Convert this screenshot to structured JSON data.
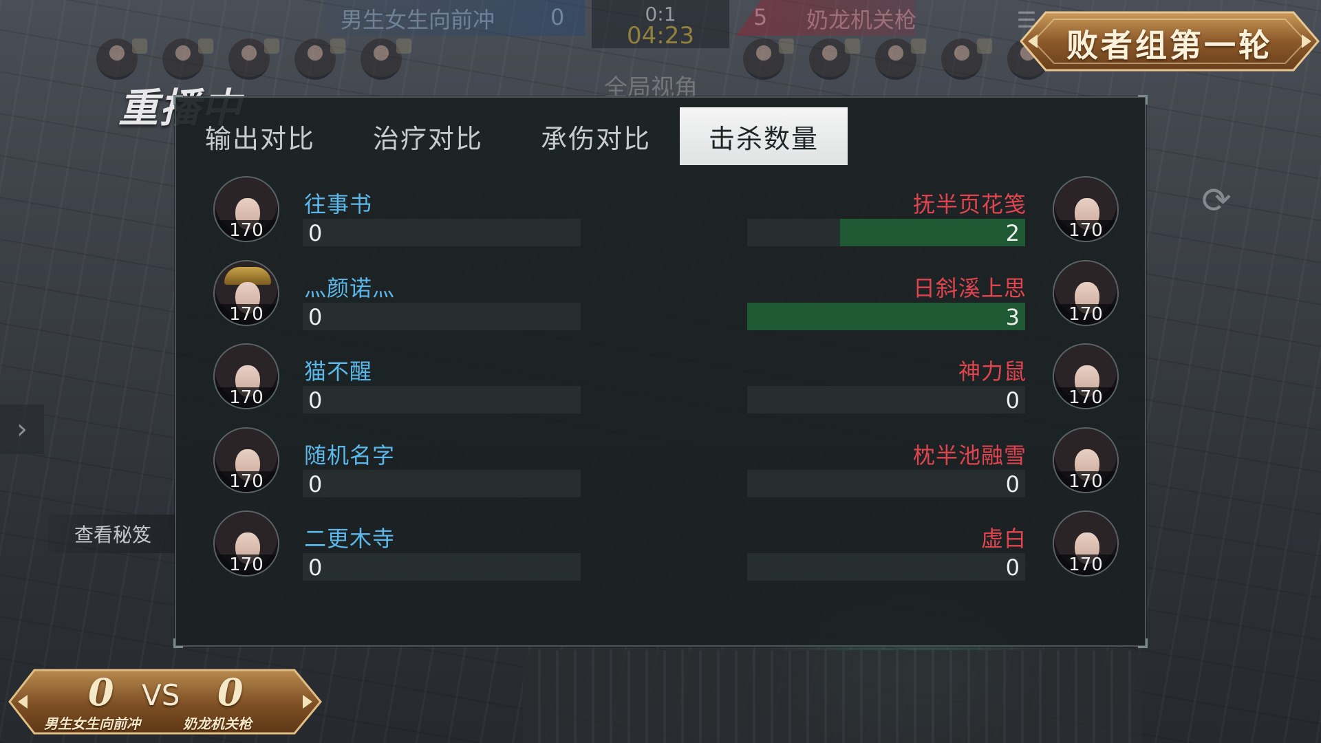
{
  "top": {
    "team_left": "男生女生向前冲",
    "team_right": "奶龙机关枪",
    "score_left": "0",
    "score_right": "5",
    "round_score": "0:1",
    "clock": "04:23",
    "view_mode": "全局视角"
  },
  "stage_title": "败者组第一轮",
  "replay_label": "重播中",
  "view_tips": "查看秘笈",
  "tabs": [
    {
      "label": "输出对比",
      "active": false
    },
    {
      "label": "治疗对比",
      "active": false
    },
    {
      "label": "承伤对比",
      "active": false
    },
    {
      "label": "击杀数量",
      "active": true
    }
  ],
  "rows": [
    {
      "left": {
        "name": "往事书",
        "level": "170",
        "value": "0",
        "fill": 0
      },
      "right": {
        "name": "抚半页花笺",
        "level": "170",
        "value": "2",
        "fill": 0.667
      }
    },
    {
      "left": {
        "name": "灬颜诺灬",
        "level": "170",
        "value": "0",
        "fill": 0
      },
      "right": {
        "name": "日斜溪上思",
        "level": "170",
        "value": "3",
        "fill": 1.0
      }
    },
    {
      "left": {
        "name": "猫不醒",
        "level": "170",
        "value": "0",
        "fill": 0
      },
      "right": {
        "name": "神力鼠",
        "level": "170",
        "value": "0",
        "fill": 0
      }
    },
    {
      "left": {
        "name": "随机名字",
        "level": "170",
        "value": "0",
        "fill": 0
      },
      "right": {
        "name": "枕半池融雪",
        "level": "170",
        "value": "0",
        "fill": 0
      }
    },
    {
      "left": {
        "name": "二更木寺",
        "level": "170",
        "value": "0",
        "fill": 0
      },
      "right": {
        "name": "虚白",
        "level": "170",
        "value": "0",
        "fill": 0
      }
    }
  ],
  "bottom": {
    "score_left": "0",
    "vs": "VS",
    "score_right": "0",
    "team_left": "男生女生向前冲",
    "team_right": "奶龙机关枪"
  },
  "colors": {
    "left_team": "#5bb8ea",
    "right_team": "#e0444f",
    "bar_fill": "#1f5a34"
  }
}
